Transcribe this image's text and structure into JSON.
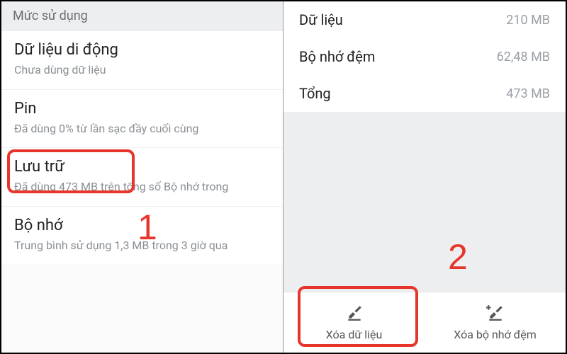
{
  "left": {
    "section_header": "Mức sử dụng",
    "items": [
      {
        "title": "Dữ liệu di động",
        "sub": "Chưa dùng dữ liệu"
      },
      {
        "title": "Pin",
        "sub": "Đã dùng 0% từ lần sạc đầy cuối cùng"
      },
      {
        "title": "Lưu trữ",
        "sub": "Đã dùng 473 MB trên tổng số Bộ nhớ trong"
      },
      {
        "title": "Bộ nhớ",
        "sub": "Trung bình sử dụng 1,3 MB trong 3 giờ qua"
      }
    ],
    "annotation_number": "1"
  },
  "right": {
    "rows": [
      {
        "label": "Dữ liệu",
        "value": "210 MB"
      },
      {
        "label": "Bộ nhớ đệm",
        "value": "62,48 MB"
      },
      {
        "label": "Tổng",
        "value": "473 MB"
      }
    ],
    "buttons": {
      "clear_data": "Xóa dữ liệu",
      "clear_cache": "Xóa bộ nhớ đệm"
    },
    "annotation_number": "2"
  }
}
